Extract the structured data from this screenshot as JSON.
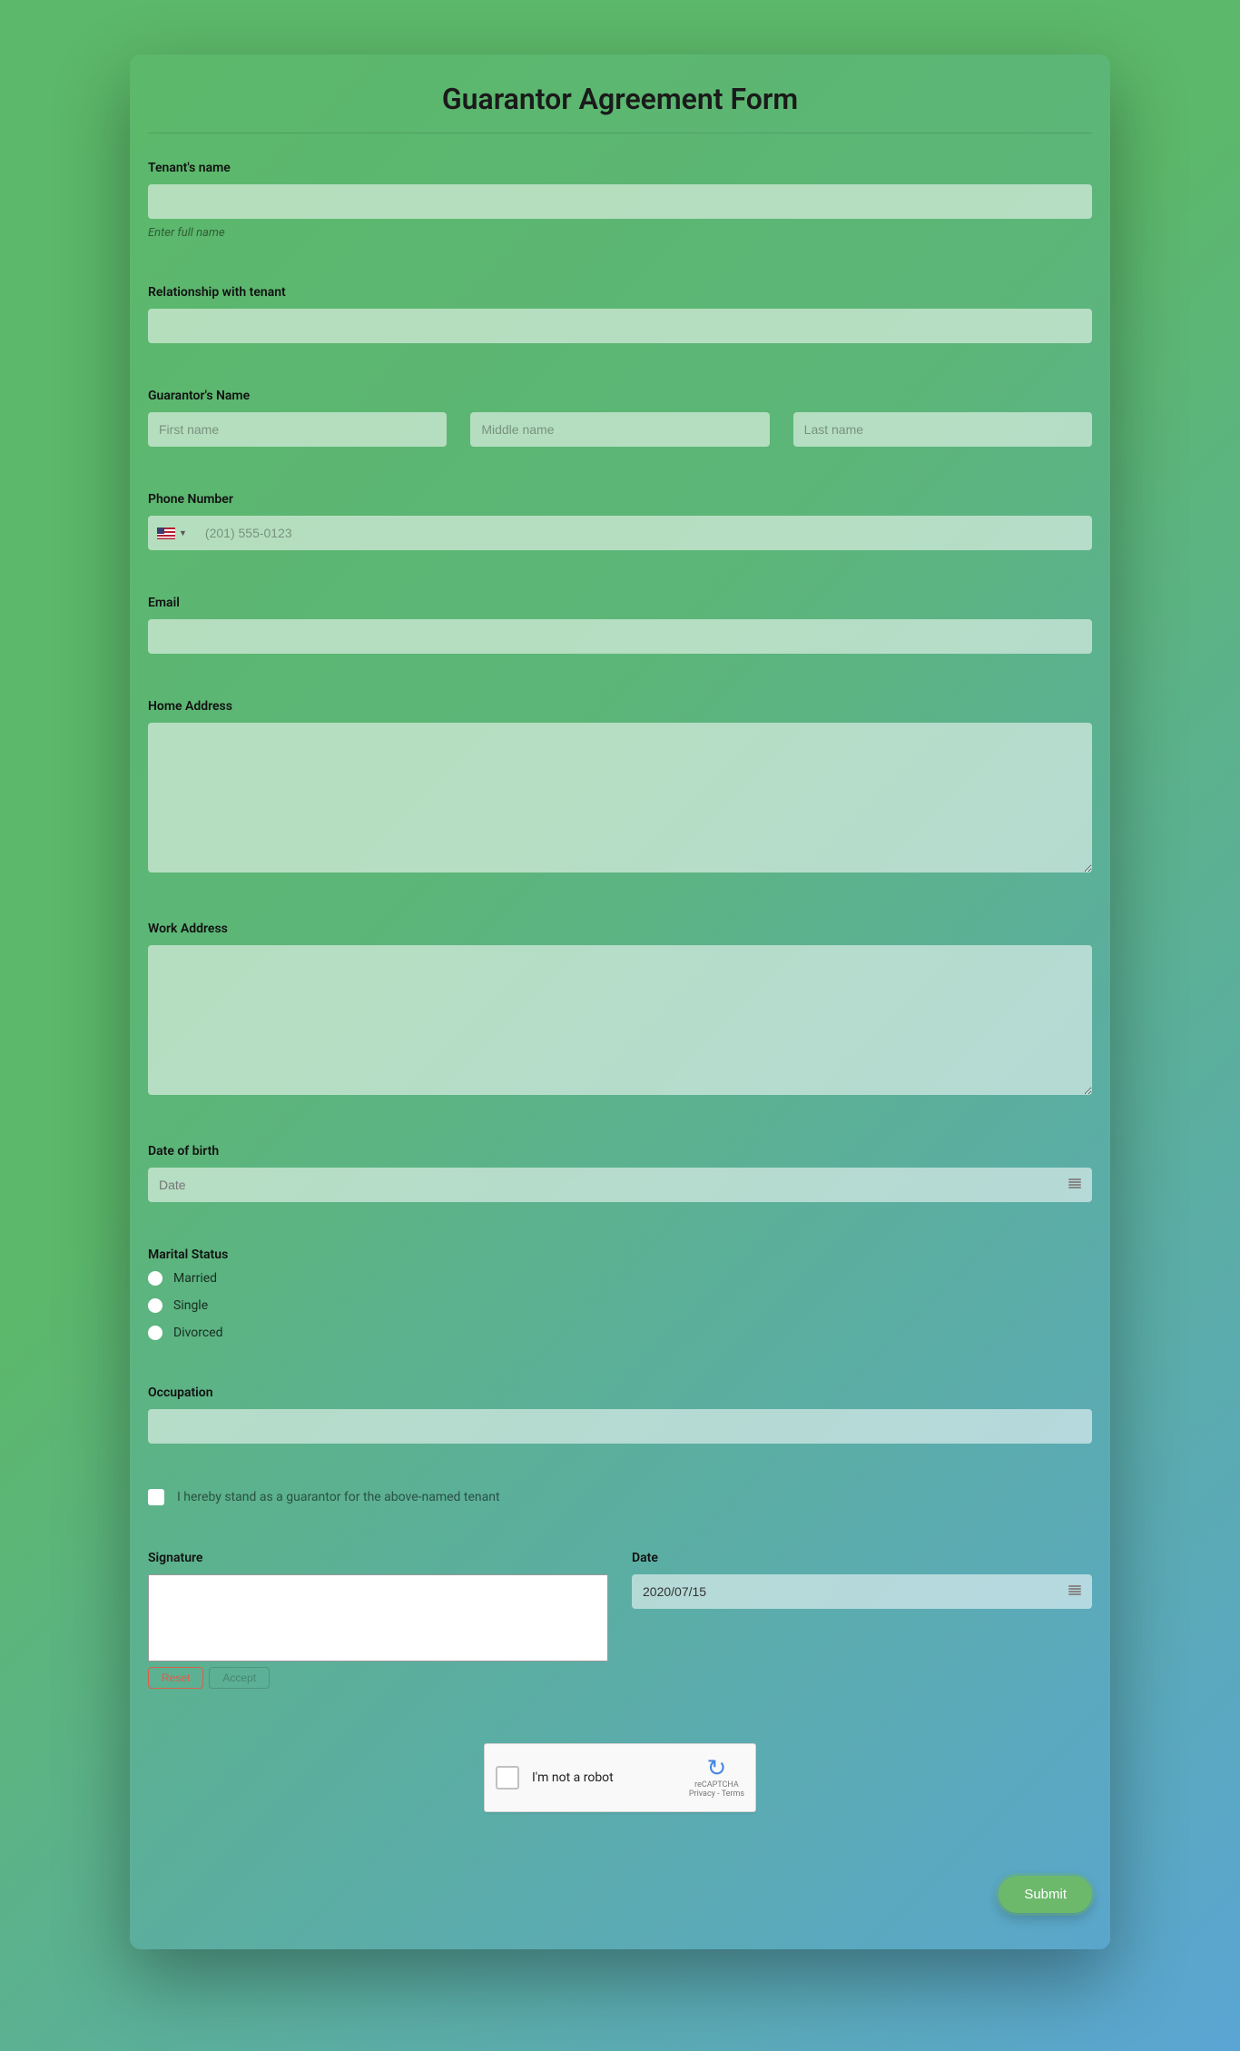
{
  "form": {
    "title": "Guarantor Agreement Form",
    "tenant_name": {
      "label": "Tenant's name",
      "helper": "Enter full name"
    },
    "relationship": {
      "label": "Relationship with tenant"
    },
    "guarantor_name": {
      "label": "Guarantor's Name",
      "first_ph": "First name",
      "middle_ph": "Middle name",
      "last_ph": "Last name"
    },
    "phone": {
      "label": "Phone Number",
      "placeholder": "(201) 555-0123"
    },
    "email": {
      "label": "Email"
    },
    "home_address": {
      "label": "Home Address"
    },
    "work_address": {
      "label": "Work Address"
    },
    "dob": {
      "label": "Date of birth",
      "placeholder": "Date"
    },
    "marital": {
      "label": "Marital Status",
      "options": [
        "Married",
        "Single",
        "Divorced"
      ]
    },
    "occupation": {
      "label": "Occupation"
    },
    "consent": {
      "label": "I hereby stand as a guarantor for the above-named tenant"
    },
    "signature": {
      "label": "Signature",
      "reset": "Reset",
      "accept": "Accept"
    },
    "date_signed": {
      "label": "Date",
      "value": "2020/07/15"
    },
    "captcha": {
      "label": "I'm not a robot",
      "brand": "reCAPTCHA",
      "legal": "Privacy - Terms"
    },
    "submit": "Submit"
  }
}
